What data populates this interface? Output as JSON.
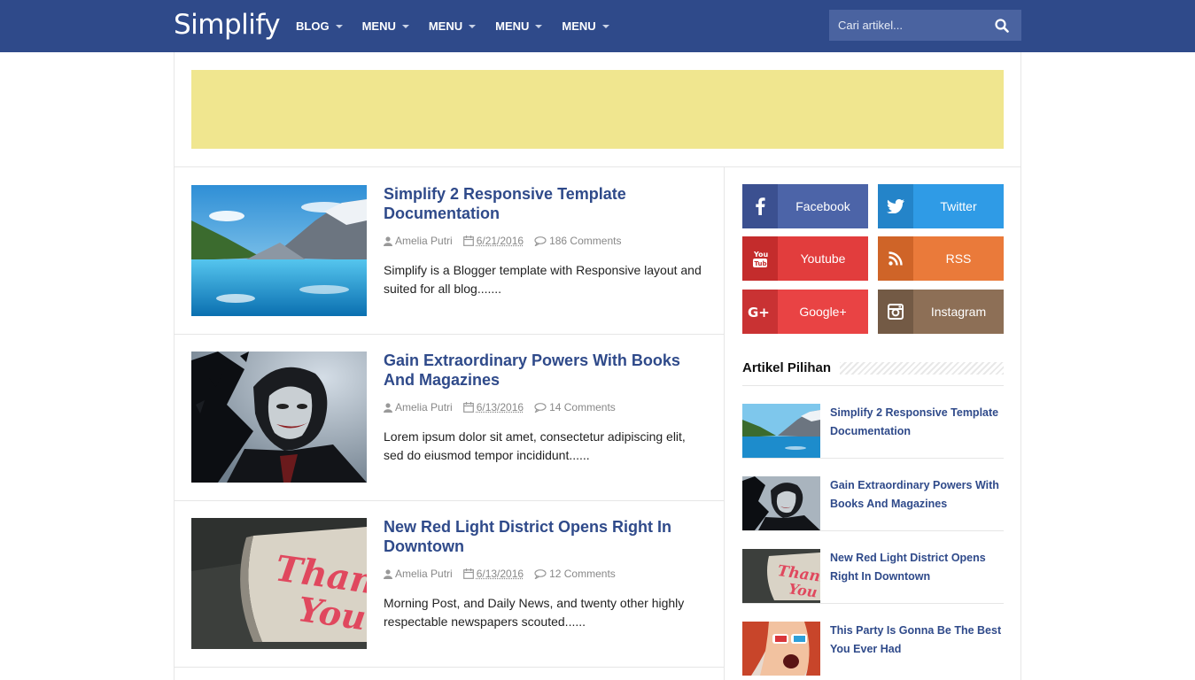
{
  "header": {
    "logo": "Simplify",
    "nav": [
      "BLOG",
      "MENU",
      "MENU",
      "MENU",
      "MENU"
    ],
    "search_placeholder": "Cari artikel..."
  },
  "posts": [
    {
      "title": "Simplify 2 Responsive Template Documentation",
      "author": "Amelia Putri",
      "date": "6/21/2016",
      "comments": "186 Comments",
      "excerpt": "Simplify is a Blogger template with Responsive layout and suited for all blog......."
    },
    {
      "title": "Gain Extraordinary Powers With Books And Magazines",
      "author": "Amelia Putri",
      "date": "6/13/2016",
      "comments": "14 Comments",
      "excerpt": "Lorem ipsum dolor sit amet, consectetur adipiscing elit, sed do eiusmod tempor incididunt......"
    },
    {
      "title": "New Red Light District Opens Right In Downtown",
      "author": "Amelia Putri",
      "date": "6/13/2016",
      "comments": "12 Comments",
      "excerpt": "Morning Post, and Daily News, and twenty other highly respectable newspapers scouted......"
    }
  ],
  "social": [
    {
      "label": "Facebook",
      "icon": "facebook-icon",
      "color": "#4c64a8",
      "dark": "#3b5090"
    },
    {
      "label": "Twitter",
      "icon": "twitter-icon",
      "color": "#2f9be6",
      "dark": "#2484c9"
    },
    {
      "label": "Youtube",
      "icon": "youtube-icon",
      "color": "#e23d3d",
      "dark": "#c42c2c"
    },
    {
      "label": "RSS",
      "icon": "rss-icon",
      "color": "#ea7a3a",
      "dark": "#cf6428"
    },
    {
      "label": "Google+",
      "icon": "google-plus-icon",
      "color": "#e94344",
      "dark": "#c93233"
    },
    {
      "label": "Instagram",
      "icon": "instagram-icon",
      "color": "#8d6f56",
      "dark": "#735a45"
    }
  ],
  "widget": {
    "title": "Artikel Pilihan",
    "items": [
      "Simplify 2 Responsive Template Documentation",
      "Gain Extraordinary Powers With Books And Magazines",
      "New Red Light District Opens Right In Downtown",
      "This Party Is Gonna Be The Best You Ever Had"
    ]
  }
}
